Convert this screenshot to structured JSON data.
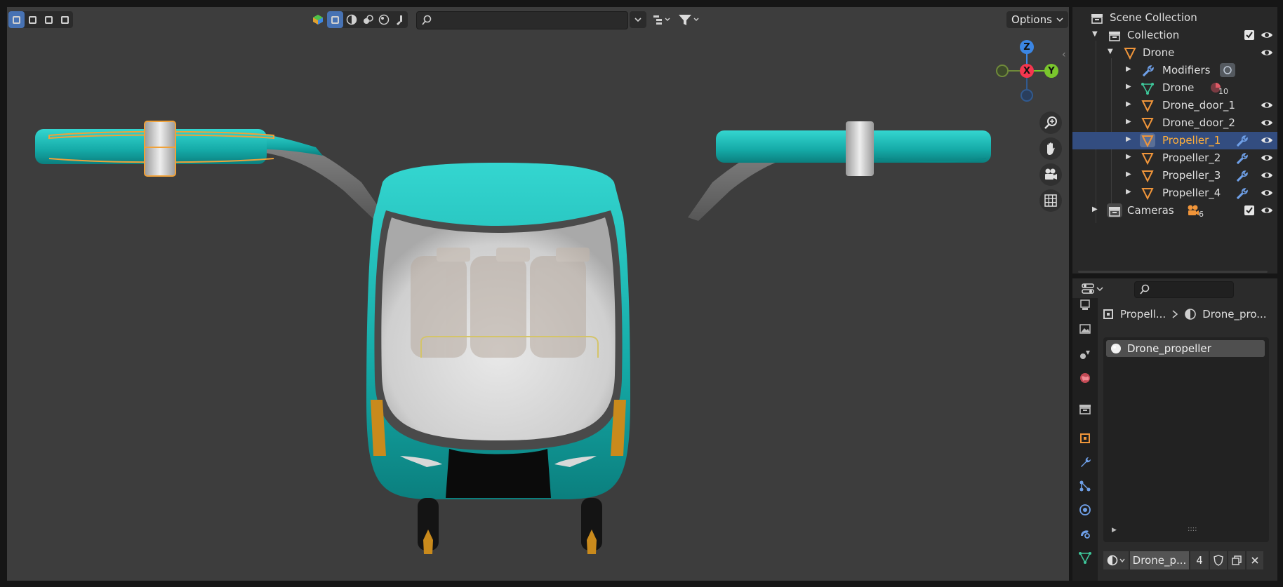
{
  "viewport": {
    "header": {
      "select_modes": [
        "select-new",
        "select-extend",
        "select-subtract",
        "select-intersect"
      ],
      "shading_modes": [
        "wireframe",
        "solid",
        "material-preview",
        "rendered"
      ],
      "search_placeholder": "",
      "options_label": "Options"
    },
    "gizmo": {
      "z": "Z",
      "x": "X",
      "y": "Y"
    },
    "nav_buttons": [
      "zoom-icon",
      "hand-pan-icon",
      "camera-icon",
      "grid-icon"
    ]
  },
  "outliner": {
    "rows": [
      {
        "label": "Scene Collection",
        "icon": "scene-collection-icon"
      },
      {
        "label": "Collection",
        "icon": "collection-icon"
      },
      {
        "label": "Drone",
        "icon": "object-icon"
      },
      {
        "label": "Modifiers",
        "icon": "wrench-icon"
      },
      {
        "label": "Drone",
        "icon": "mesh-data-icon",
        "badge": "10"
      },
      {
        "label": "Drone_door_1",
        "icon": "object-icon"
      },
      {
        "label": "Drone_door_2",
        "icon": "object-icon"
      },
      {
        "label": "Propeller_1",
        "icon": "object-icon",
        "selected": true
      },
      {
        "label": "Propeller_2",
        "icon": "object-icon"
      },
      {
        "label": "Propeller_3",
        "icon": "object-icon"
      },
      {
        "label": "Propeller_4",
        "icon": "object-icon"
      },
      {
        "label": "Cameras",
        "icon": "collection-icon",
        "badge": "6"
      }
    ]
  },
  "properties": {
    "search_placeholder": "",
    "breadcrumb": {
      "object": "Propell...",
      "material": "Drone_pro..."
    },
    "material_slots": [
      "Drone_propeller"
    ],
    "material_bar": {
      "name": "Drone_p...",
      "users": "4"
    }
  },
  "colors": {
    "accent": "#4772b3",
    "selection_row": "#334d80",
    "highlight_text": "#ffaf3a",
    "axis_x": "#f5364f",
    "axis_y": "#7ac62d",
    "axis_z": "#3b86e4",
    "drone_teal": "#1bb3b0"
  }
}
